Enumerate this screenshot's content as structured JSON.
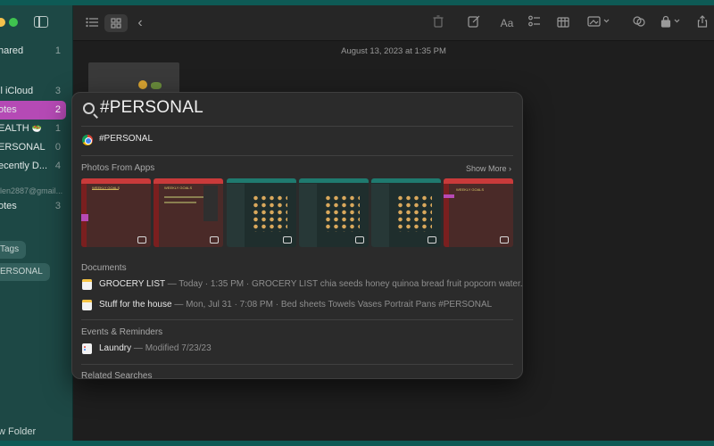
{
  "sidebar": {
    "items": [
      {
        "label": "hared",
        "count": "1"
      },
      {
        "label": "ll iCloud",
        "count": "3"
      },
      {
        "label": "otes",
        "count": "2"
      },
      {
        "label": "EALTH",
        "count": "1"
      },
      {
        "label": "ERSONAL",
        "count": "0"
      },
      {
        "label": "ecently D...",
        "count": "4"
      },
      {
        "label": "otes",
        "count": "3"
      }
    ],
    "account": "llen2887@gmail...",
    "tags_header": "Tags",
    "tag": "ERSONAL",
    "new_folder": "w Folder",
    "health_emoji": "🥗"
  },
  "toolbar": {
    "list_icon": "list-view-icon",
    "grid_icon": "gallery-view-icon",
    "back_icon": "chevron-left-icon",
    "trash_icon": "trash-icon",
    "compose_icon": "compose-icon",
    "format_label": "Aa",
    "checklist_icon": "checklist-icon",
    "table_icon": "table-icon",
    "media_icon": "media-icon",
    "collab_icon": "collaborate-icon",
    "lock_icon": "lock-icon",
    "share_icon": "share-icon"
  },
  "note": {
    "date": "August 13, 2023 at 1:35 PM"
  },
  "spotlight": {
    "query": "#PERSONAL",
    "top_hit": "#PERSONAL",
    "photos_header": "Photos From Apps",
    "show_more": "Show More",
    "photos": [
      {
        "caption": "WEEKLY GOALS"
      },
      {
        "caption": "WEEKLY GOALS"
      },
      {
        "caption": ""
      },
      {
        "caption": ""
      },
      {
        "caption": ""
      },
      {
        "caption": "WEEKLY GOALS"
      }
    ],
    "documents_header": "Documents",
    "documents": [
      {
        "title": "GROCERY LIST",
        "meta": " — Today · 1:35 PM · GROCERY LIST chia seeds honey quinoa bread fruit popcorn water..."
      },
      {
        "title": "Stuff for the house",
        "meta": " — Mon, Jul 31 · 7:08 PM · Bed sheets Towels Vases Portrait Pans #PERSONAL"
      }
    ],
    "events_header": "Events & Reminders",
    "events": [
      {
        "title": "Laundry",
        "meta": " — Modified 7/23/23"
      }
    ],
    "related_header": "Related Searches"
  },
  "colors": {
    "selected_folder": "#b54ab5",
    "sidebar_bg": "#1d4845",
    "desktop": "#0e5a55"
  }
}
